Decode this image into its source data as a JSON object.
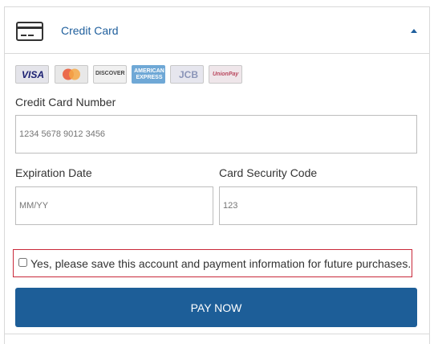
{
  "header": {
    "title": "Credit Card",
    "icon": "credit-card-icon",
    "collapse_icon": "caret-up-icon",
    "accent_color": "#1f5f9d"
  },
  "card_logos": [
    {
      "name": "visa",
      "text": "VISA"
    },
    {
      "name": "mastercard",
      "text": ""
    },
    {
      "name": "discover",
      "text": "DISCOVER"
    },
    {
      "name": "american-express",
      "text": "AMERICAN EXPRESS"
    },
    {
      "name": "jcb",
      "text": "JCB"
    },
    {
      "name": "unionpay",
      "text": "UnionPay"
    }
  ],
  "form": {
    "card_number_label": "Credit Card Number",
    "card_number_placeholder": "1234 5678 9012 3456",
    "expiration_label": "Expiration Date",
    "expiration_placeholder": "MM/YY",
    "security_code_label": "Card Security Code",
    "security_code_placeholder": "123"
  },
  "save_option": {
    "label": "Yes, please save this account and payment information for future purchases.",
    "checked": false,
    "border_color": "#c9293a"
  },
  "pay_button": {
    "label": "PAY NOW",
    "color": "#1d5e98"
  }
}
